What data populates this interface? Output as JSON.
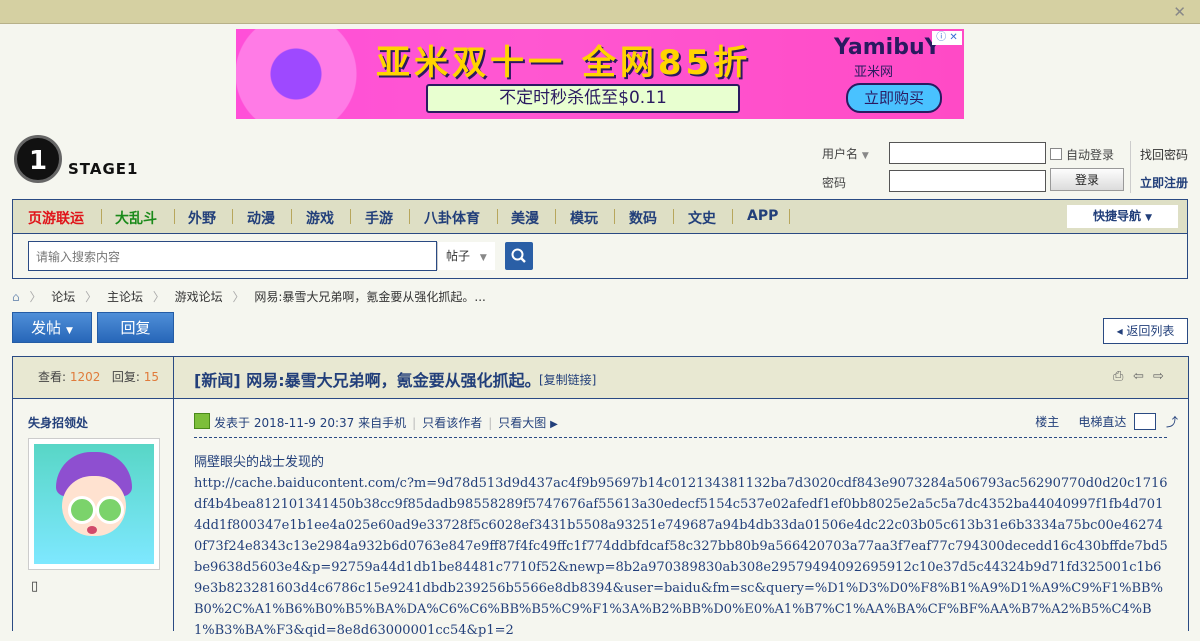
{
  "topbar": {
    "close_glyph": "✕"
  },
  "ad": {
    "headline": "亚米双十一 全网85折",
    "brand": "YamibuY",
    "brand_cn": "亚米网",
    "sub": "不定时秒杀低至$0.11",
    "buy": "立即购买",
    "badge": "ⓘ ✕"
  },
  "logo": {
    "mark": "1",
    "text": "STAGE1"
  },
  "login": {
    "username_label": "用户名",
    "password_label": "密码",
    "auto_login": "自动登录",
    "login_button": "登录",
    "forgot": "找回密码",
    "register": "立即注册"
  },
  "nav": {
    "items": [
      {
        "label": "页游联运",
        "color": "#e0141a"
      },
      {
        "label": "大乱斗",
        "color": "#1a8a1a"
      },
      {
        "label": "外野"
      },
      {
        "label": "动漫"
      },
      {
        "label": "游戏"
      },
      {
        "label": "手游"
      },
      {
        "label": "八卦体育"
      },
      {
        "label": "美漫"
      },
      {
        "label": "模玩"
      },
      {
        "label": "数码"
      },
      {
        "label": "文史"
      },
      {
        "label": "APP"
      }
    ],
    "quick": "快捷导航"
  },
  "search": {
    "placeholder": "请输入搜索内容",
    "category": "帖子"
  },
  "breadcrumb": [
    "论坛",
    "主论坛",
    "游戏论坛",
    "网易:暴雪大兄弟啊，氪金要从强化抓起。..."
  ],
  "actions": {
    "post": "发帖",
    "reply": "回复",
    "back": "返回列表"
  },
  "thread": {
    "views_label": "查看:",
    "views": "1202",
    "replies_label": "回复:",
    "replies": "15",
    "title": "[新闻] 网易:暴雪大兄弟啊，氪金要从强化抓起。",
    "copy_link": "[复制链接]",
    "author": "失身招领处",
    "posted": "发表于 2018-11-9 20:37 来自手机",
    "only_author": "只看该作者",
    "only_big": "只看大图",
    "floor": "楼主",
    "elevator": "电梯直达",
    "body_line1": "隔壁眼尖的战士发现的",
    "body_line2": "http://cache.baiducontent.com/c?m=9d78d513d9d437ac4f9b95697b14c012134381132ba7d3020cdf843e9073284a506793ac56290770d0d20c1716df4b4bea812101341450b38cc9f85dadb98558289f5747676af55613a30edecf5154c537e02afedf1ef0bb8025e2a5c5a7dc4352ba44040997f1fb4d7014dd1f800347e1b1ee4a025e60ad9e33728f5c6028ef3431b5508a93251e749687a94b4db33da01506e4dc22c03b05c613b31e6b3334a75bc00e462740f73f24e8343c13e2984a932b6d0763e847e9ff87f4fc49ffc1f774ddbfdcaf58c327bb80b9a566420703a77aa3f7eaf77c794300decedd16c430bffde7bd5be9638d5603e4&p=92759a44d1db1be84481c7710f52&newp=8b2a970389830ab308e29579494092695912c10e37d5c44324b9d71fd325001c1b69e3b823281603d4c6786c15e9241dbdb239256b5566e8db8394&user=baidu&fm=sc&query=%D1%D3%D0%F8%B1%A9%D1%A9%C9%F1%BB%B0%2C%A1%B6%B0%B5%BA%DA%C6%C6%BB%B5%C9%F1%3A%B2%BB%D0%E0%A1%B7%C1%AA%BA%CF%BF%AA%B7%A2%B5%C4%B1%B3%BA%F3&qid=8e8d63000001cc54&p1=2"
  }
}
